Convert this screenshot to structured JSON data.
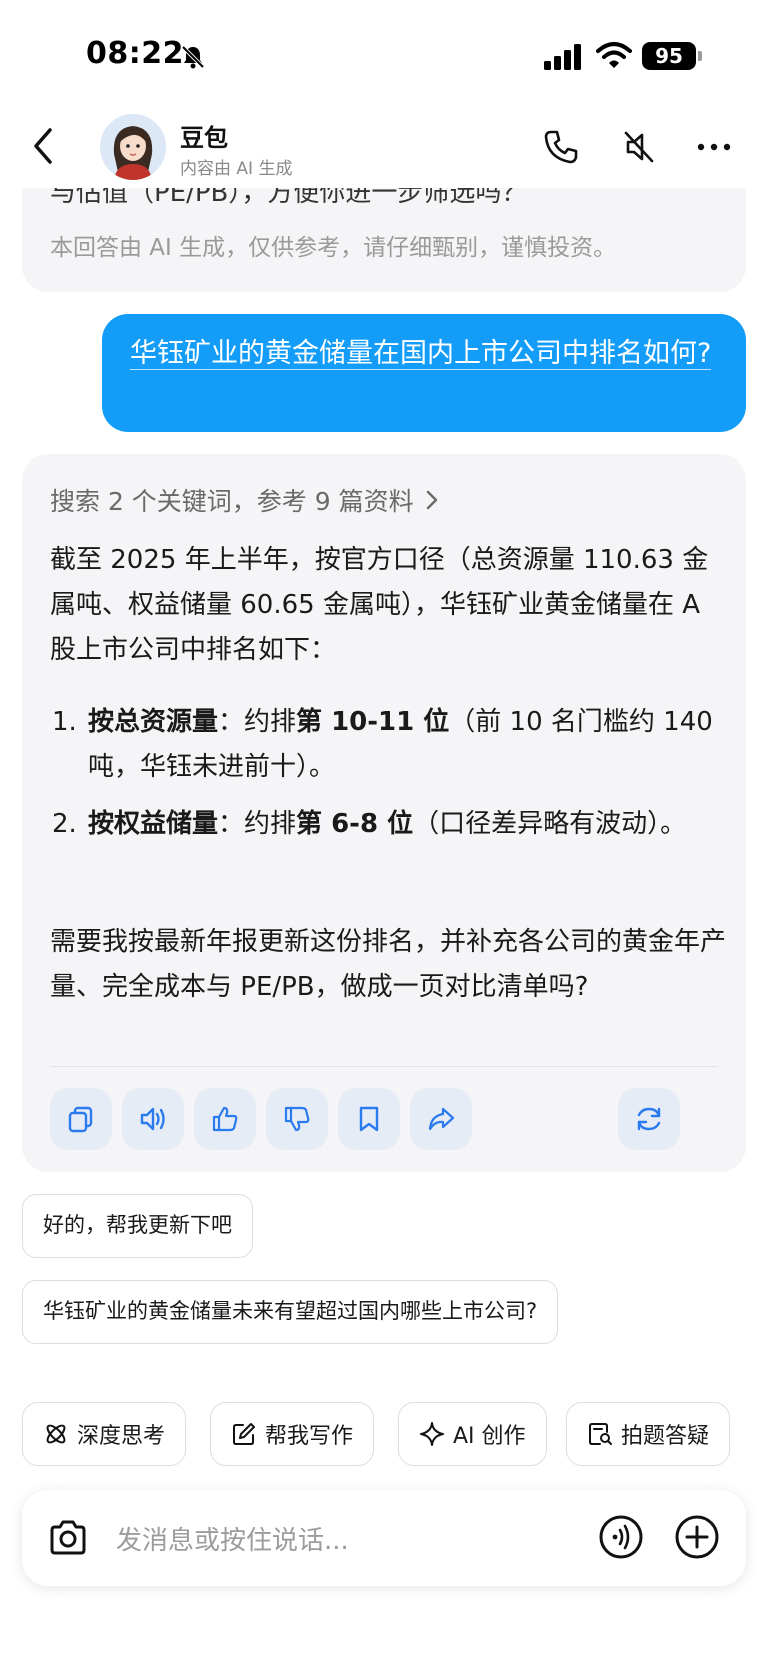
{
  "status_bar": {
    "time": "08:22",
    "battery": "95"
  },
  "header": {
    "title": "豆包",
    "subtitle": "内容由 AI 生成"
  },
  "previous_message": {
    "cut_text": "与估值（PE/PB），方便你进一步筛选吗？",
    "disclaimer": "本回答由 AI 生成，仅供参考，请仔细甄别，谨慎投资。"
  },
  "user_message": {
    "text": "华钰矿业的黄金储量在国内上市公司中排名如何?"
  },
  "ai_answer": {
    "search_ref": "搜索 2 个关键词，参考 9 篇资料",
    "intro": "截至 2025 年上半年，按官方口径（总资源量 110.63 金属吨、权益储量 60.65 金属吨），华钰矿业黄金储量在 A 股上市公司中排名如下：",
    "list": [
      {
        "num": "1.",
        "label": "按总资源量",
        "sep": "：约排",
        "rank": "第 10-11 位",
        "rest": "（前 10 名门槛约 140 吨，华钰未进前十）。"
      },
      {
        "num": "2.",
        "label": "按权益储量",
        "sep": "：约排",
        "rank": "第 6-8 位",
        "rest": "（口径差异略有波动）。"
      }
    ],
    "outro": "需要我按最新年报更新这份排名，并补充各公司的黄金年产量、完全成本与 PE/PB，做成一页对比清单吗?"
  },
  "suggestions": [
    "好的，帮我更新下吧",
    "华钰矿业的黄金储量未来有望超过国内哪些上市公司?"
  ],
  "chips": [
    {
      "label": "深度思考",
      "icon": "atom-icon"
    },
    {
      "label": "帮我写作",
      "icon": "edit-icon"
    },
    {
      "label": "AI 创作",
      "icon": "sparkle-icon"
    },
    {
      "label": "拍题答疑",
      "icon": "doc-search-icon"
    }
  ],
  "input": {
    "placeholder": "发消息或按住说话..."
  },
  "colors": {
    "accent": "#139df9",
    "bubble_bg": "#f5f5f7",
    "action_bg": "#e6ecf6",
    "icon_blue": "#2a7bf0"
  }
}
